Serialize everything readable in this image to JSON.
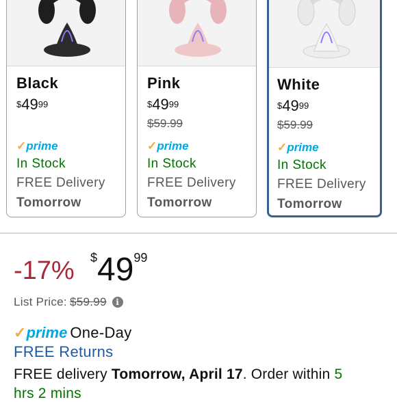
{
  "variants": [
    {
      "name": "Black",
      "price_symbol": "$",
      "price_whole": "49",
      "price_cents": "99",
      "list_price": "",
      "prime": "prime",
      "stock": "In Stock",
      "delivery": "FREE Delivery",
      "delivery_day": "Tomorrow",
      "headset_color": "#1e1e1e",
      "stand_color": "#2b2b2b",
      "selected": false
    },
    {
      "name": "Pink",
      "price_symbol": "$",
      "price_whole": "49",
      "price_cents": "99",
      "list_price": "$59.99",
      "prime": "prime",
      "stock": "In Stock",
      "delivery": "FREE Delivery",
      "delivery_day": "Tomorrow",
      "headset_color": "#e7b5b9",
      "stand_color": "#f0c7c9",
      "selected": false
    },
    {
      "name": "White",
      "price_symbol": "$",
      "price_whole": "49",
      "price_cents": "99",
      "list_price": "$59.99",
      "prime": "prime",
      "stock": "In Stock",
      "delivery": "FREE Delivery",
      "delivery_day": "Tomorrow",
      "headset_color": "#e9e9e9",
      "stand_color": "#f4f4f4",
      "selected": true
    }
  ],
  "deal": {
    "discount": "-17%",
    "price_symbol": "$",
    "price_whole": "49",
    "price_cents": "99",
    "list_price_label": "List Price:",
    "list_price": "$59.99",
    "info_icon": "i"
  },
  "shipping": {
    "prime": "prime",
    "one_day": "One-Day",
    "returns": "FREE Returns",
    "delivery_prefix": "FREE delivery",
    "delivery_date": "Tomorrow, April 17",
    "order_within": ". Order within",
    "countdown_a": "5",
    "countdown_b": "hrs 2 mins"
  },
  "colors": {
    "prime_blue": "#00a8e1",
    "check_orange": "#f3a847",
    "stock_green": "#007600",
    "discount_red": "#a52a3a",
    "link_blue": "#1f5aa6",
    "selected_border": "#3a5f94"
  },
  "icons": {
    "prime_check": "checkmark-icon",
    "info": "info-icon"
  }
}
